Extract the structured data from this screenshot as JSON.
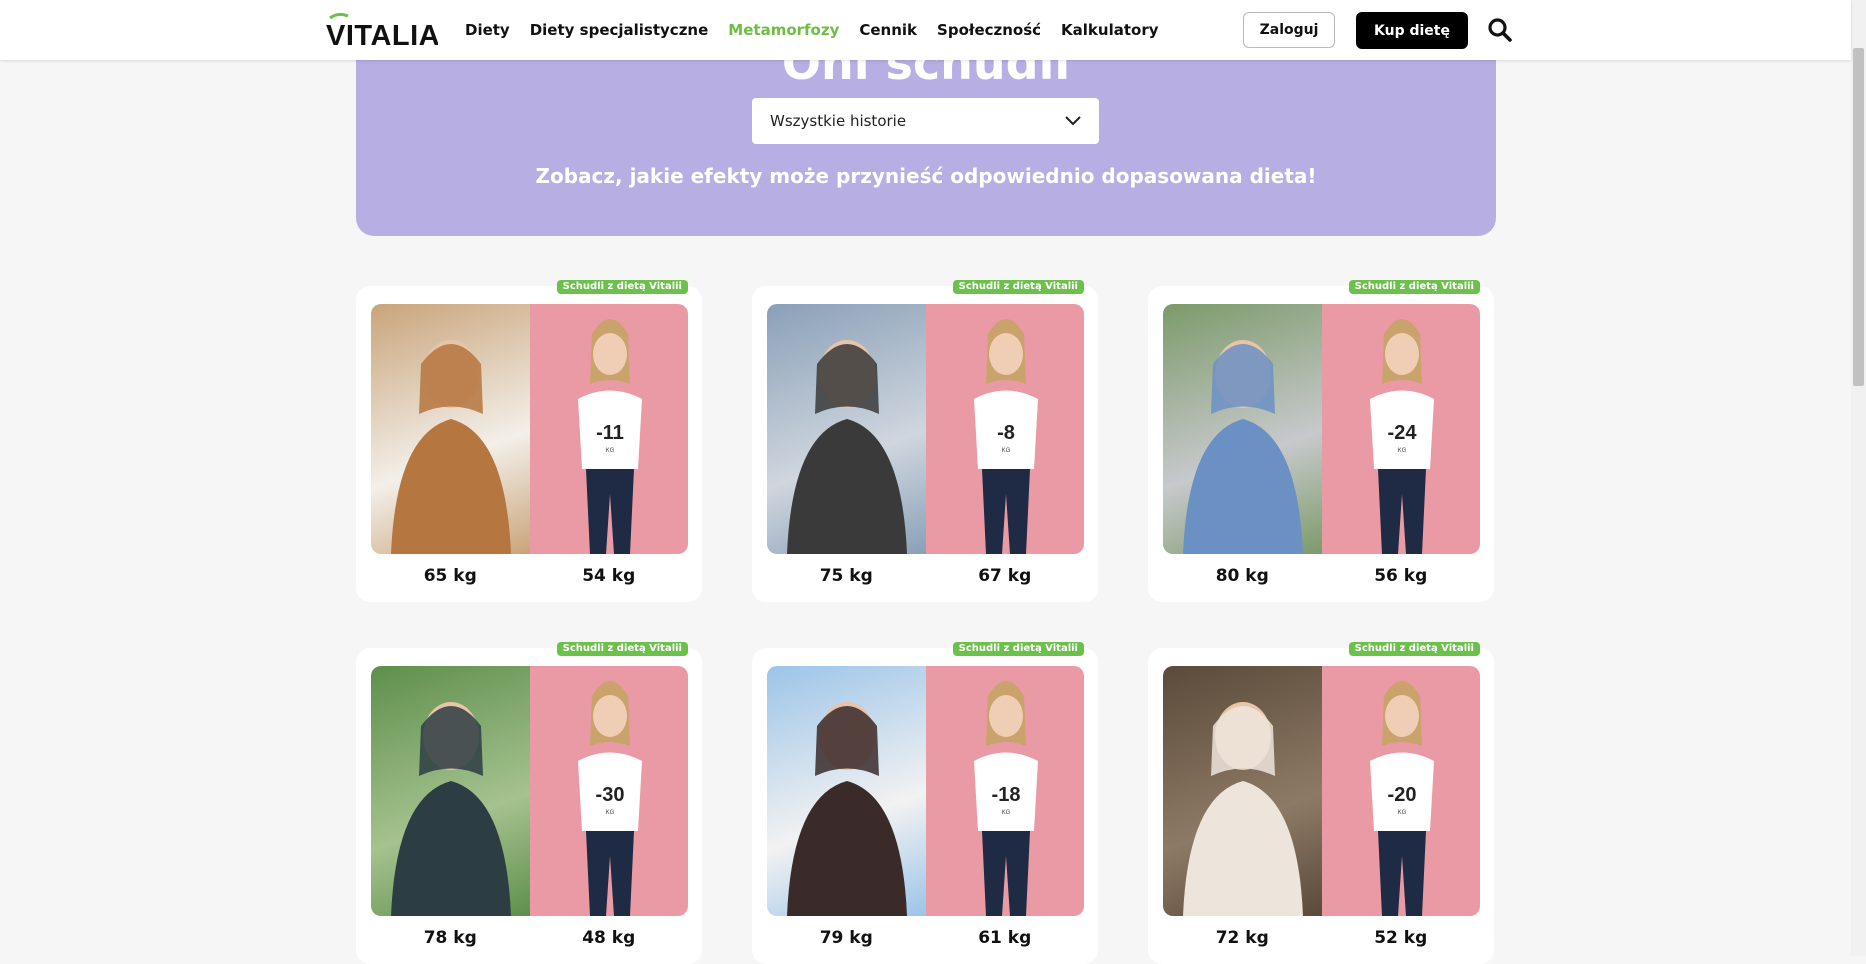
{
  "nav": {
    "logo_text": "VITALIA",
    "items": [
      {
        "label": "Diety",
        "active": false
      },
      {
        "label": "Diety specjalistyczne",
        "active": false
      },
      {
        "label": "Metamorfozy",
        "active": true
      },
      {
        "label": "Cennik",
        "active": false
      },
      {
        "label": "Społeczność",
        "active": false
      },
      {
        "label": "Kalkulatory",
        "active": false
      }
    ],
    "login_label": "Zaloguj",
    "buy_label": "Kup dietę",
    "search_icon": "search-icon"
  },
  "hero": {
    "title": "Oni schudli",
    "filter_value": "Wszystkie historie",
    "subtitle": "Zobacz, jakie efekty może przynieść odpowiednio dopasowana dieta!"
  },
  "colors": {
    "accent_green": "#6cc14a",
    "hero_bg": "#b7aee3",
    "after_bg": "#e99aa4"
  },
  "cards": [
    {
      "badge": "Schudli z dietą Vitalii",
      "before": "65 kg",
      "after": "54 kg",
      "shirt": "-11",
      "shirt_unit": "KG"
    },
    {
      "badge": "Schudli z dietą Vitalii",
      "before": "75 kg",
      "after": "67 kg",
      "shirt": "-8",
      "shirt_unit": "KG"
    },
    {
      "badge": "Schudli z dietą Vitalii",
      "before": "80 kg",
      "after": "56 kg",
      "shirt": "-24",
      "shirt_unit": "KG"
    },
    {
      "badge": "Schudli z dietą Vitalii",
      "before": "78 kg",
      "after": "48 kg",
      "shirt": "-30",
      "shirt_unit": "KG"
    },
    {
      "badge": "Schudli z dietą Vitalii",
      "before": "79 kg",
      "after": "61 kg",
      "shirt": "-18",
      "shirt_unit": "KG"
    },
    {
      "badge": "Schudli z dietą Vitalii",
      "before": "72 kg",
      "after": "52 kg",
      "shirt": "-20",
      "shirt_unit": "KG"
    }
  ]
}
